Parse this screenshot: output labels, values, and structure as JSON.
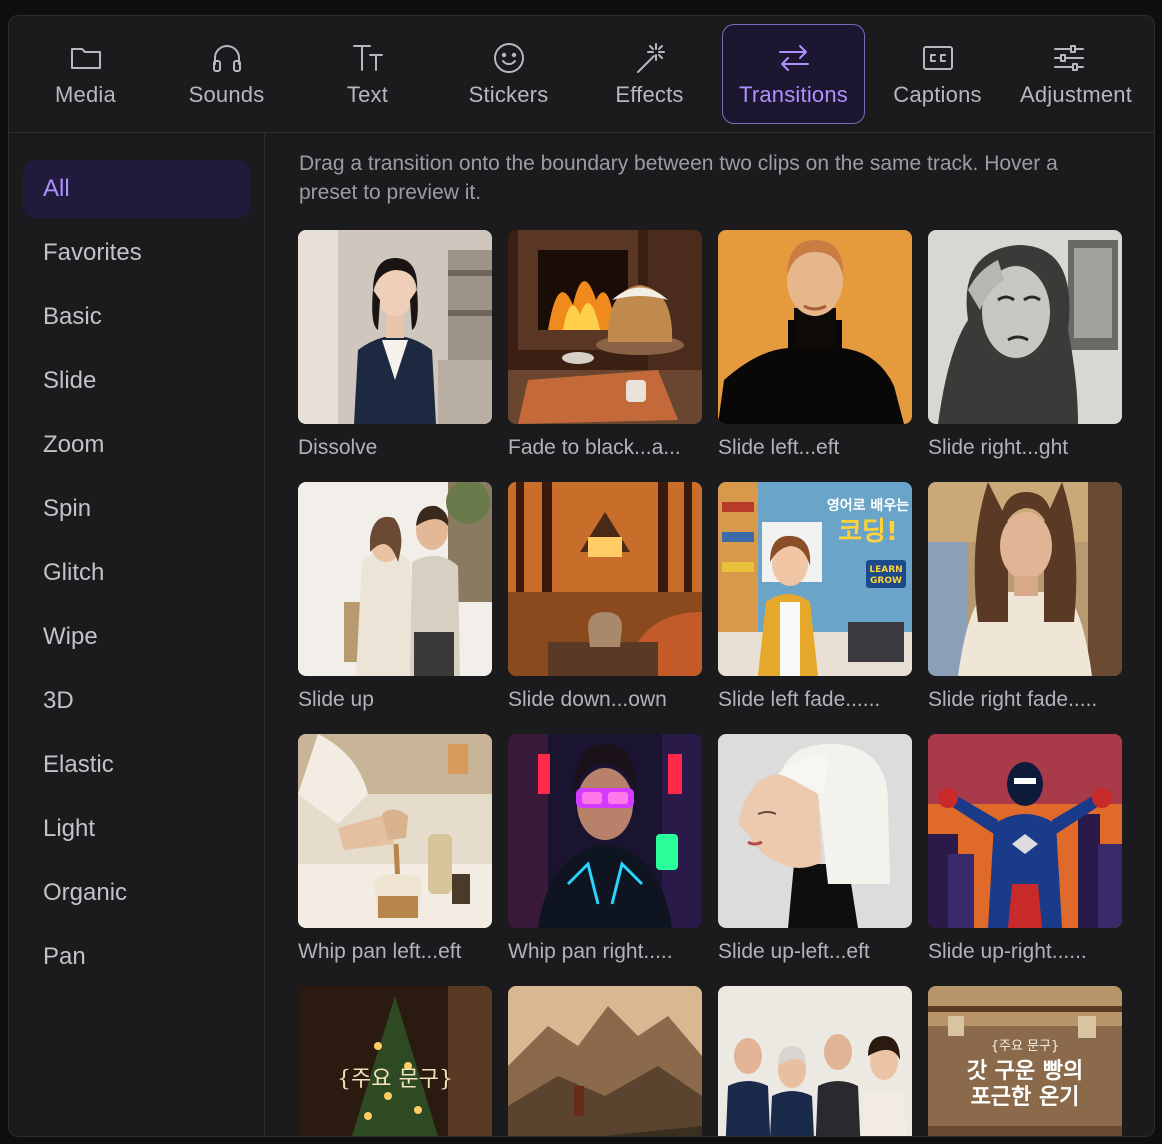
{
  "toolbar": {
    "items": [
      {
        "label": "Media",
        "icon": "folder-icon"
      },
      {
        "label": "Sounds",
        "icon": "headphones-icon"
      },
      {
        "label": "Text",
        "icon": "text-icon"
      },
      {
        "label": "Stickers",
        "icon": "smiley-icon"
      },
      {
        "label": "Effects",
        "icon": "magic-wand-icon"
      },
      {
        "label": "Transitions",
        "icon": "swap-arrows-icon"
      },
      {
        "label": "Captions",
        "icon": "closed-captions-icon"
      },
      {
        "label": "Adjustment",
        "icon": "sliders-icon"
      }
    ],
    "active": "Transitions",
    "accent": "#a993ff"
  },
  "sidebar": {
    "categories": [
      "All",
      "Favorites",
      "Basic",
      "Slide",
      "Zoom",
      "Spin",
      "Glitch",
      "Wipe",
      "3D",
      "Elastic",
      "Light",
      "Organic",
      "Pan"
    ],
    "active": "All"
  },
  "main": {
    "hint": "Drag a transition onto the boundary between two clips on the same track. Hover a preset to preview it.",
    "presets": [
      {
        "label": "Dissolve",
        "thumb": "businesswoman-portrait"
      },
      {
        "label": "Fade to black...a...",
        "thumb": "fireplace-bread"
      },
      {
        "label": "Slide left...eft",
        "thumb": "woman-turtleneck-orange"
      },
      {
        "label": "Slide right...ght",
        "thumb": "pencil-sketch-woman"
      },
      {
        "label": "Slide up",
        "thumb": "pregnant-couple"
      },
      {
        "label": "Slide down...own",
        "thumb": "autumn-cabin-mug"
      },
      {
        "label": "Slide left fade......",
        "thumb": "coding-course-woman",
        "text": [
          "영어로 배우는",
          "코딩!",
          "LEARN",
          "GROW"
        ]
      },
      {
        "label": "Slide right fade.....",
        "thumb": "woman-lace-top"
      },
      {
        "label": "Whip pan left...eft",
        "thumb": "pouring-coffee"
      },
      {
        "label": "Whip pan right.....",
        "thumb": "cyberpunk-girl"
      },
      {
        "label": "Slide up-left...eft",
        "thumb": "white-bob-woman"
      },
      {
        "label": "Slide up-right......",
        "thumb": "comic-superhero"
      },
      {
        "label": "",
        "thumb": "christmas-tree",
        "text": [
          "{주요 문구}"
        ]
      },
      {
        "label": "",
        "thumb": "mountain-valley"
      },
      {
        "label": "",
        "thumb": "family-portrait"
      },
      {
        "label": "",
        "thumb": "bakery-korean-text",
        "text": [
          "{주요 문구}",
          "갓 구운 빵의",
          "포근한 온기"
        ]
      }
    ]
  }
}
